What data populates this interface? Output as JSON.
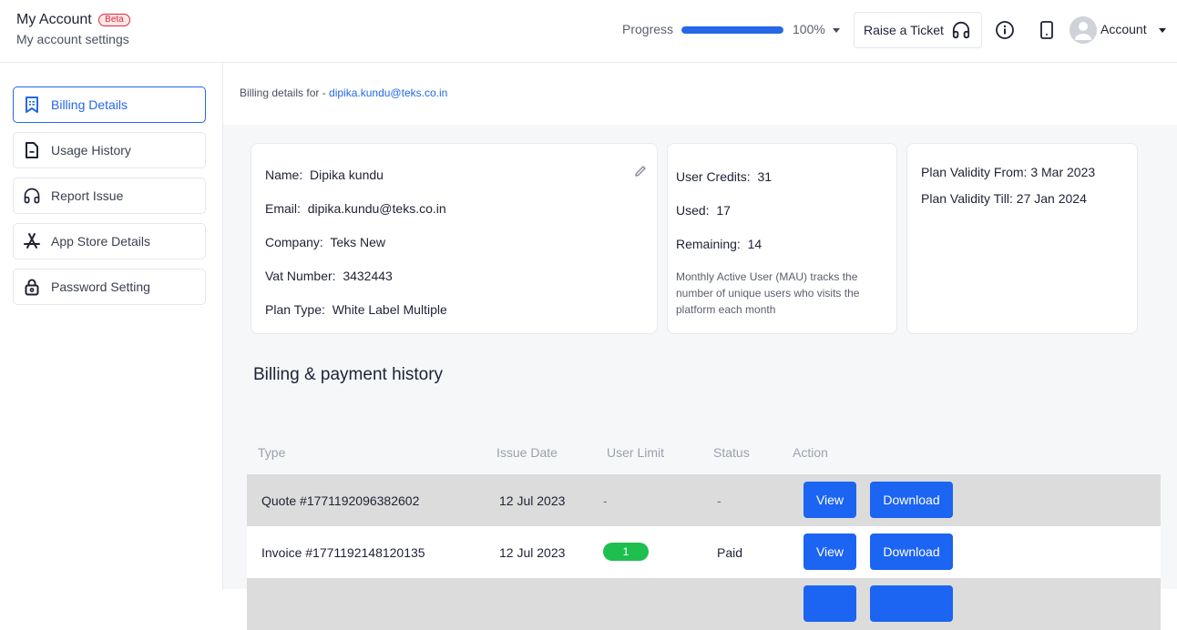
{
  "header": {
    "title": "My Account",
    "badge": "Beta",
    "subtitle": "My account settings",
    "progress_label": "Progress",
    "progress_value": 100,
    "progress_text": "100%",
    "raise_ticket_label": "Raise a Ticket",
    "account_label": "Account"
  },
  "sidebar": {
    "items": [
      {
        "label": "Billing Details",
        "icon": "receipt-icon",
        "active": true
      },
      {
        "label": "Usage History",
        "icon": "document-icon",
        "active": false
      },
      {
        "label": "Report Issue",
        "icon": "headphones-icon",
        "active": false
      },
      {
        "label": "App Store Details",
        "icon": "app-store-icon",
        "active": false
      },
      {
        "label": "Password Setting",
        "icon": "lock-icon",
        "active": false
      }
    ]
  },
  "billing_for": {
    "prefix": "Billing details for - ",
    "email": "dipika.kundu@teks.co.in"
  },
  "profile_card": {
    "name_label": "Name:",
    "name": "Dipika kundu",
    "email_label": "Email:",
    "email": "dipika.kundu@teks.co.in",
    "company_label": "Company:",
    "company": "Teks New",
    "vat_label": "Vat Number:",
    "vat": "3432443",
    "plan_label": "Plan Type:",
    "plan": "White Label Multiple"
  },
  "credits_card": {
    "credits_label": "User Credits:",
    "credits": "31",
    "used_label": "Used:",
    "used": "17",
    "remaining_label": "Remaining:",
    "remaining": "14",
    "note": "Monthly Active User (MAU) tracks the number of unique users who visits the platform each month"
  },
  "validity_card": {
    "from": "Plan Validity From: 3 Mar 2023",
    "till": "Plan Validity Till: 27 Jan 2024"
  },
  "history": {
    "title": "Billing & payment history",
    "columns": [
      "Type",
      "Issue Date",
      "User Limit",
      "Status",
      "Action"
    ],
    "rows": [
      {
        "type": "Quote #1771192096382602",
        "issue_date": "12 Jul 2023",
        "user_limit": "-",
        "status": "-",
        "view": "View",
        "download": "Download"
      },
      {
        "type": "Invoice #1771192148120135",
        "issue_date": "12 Jul 2023",
        "user_limit": "1",
        "status": "Paid",
        "view": "View",
        "download": "Download"
      }
    ]
  },
  "colors": {
    "accent": "#1c64f2",
    "success": "#1fbf4f",
    "beta": "#e02a3a"
  }
}
